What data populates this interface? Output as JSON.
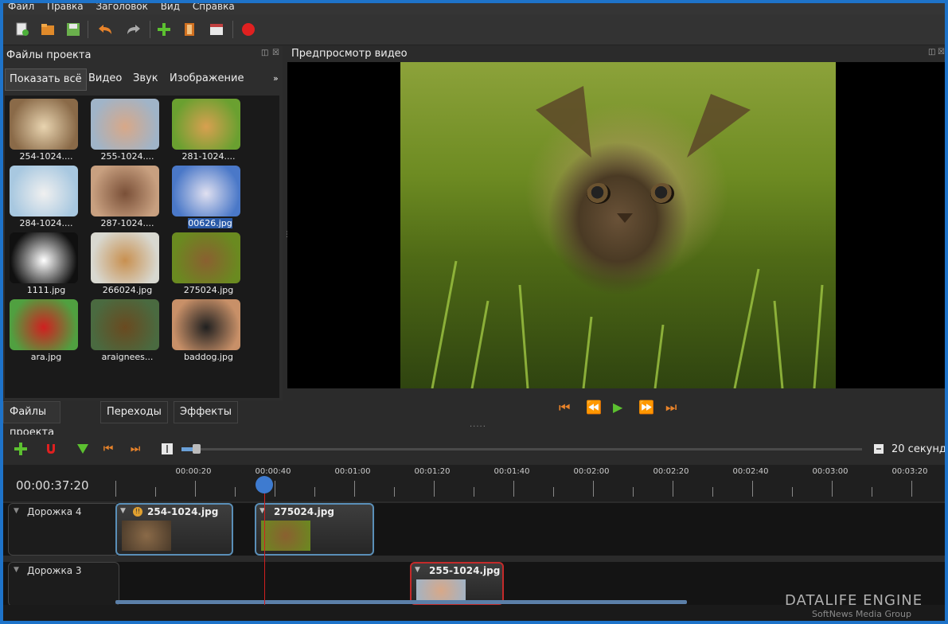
{
  "menu": [
    "Файл",
    "Правка",
    "Заголовок",
    "Вид",
    "Справка"
  ],
  "left_panel": {
    "title": "Файлы проекта",
    "filters": [
      "Показать всё",
      "Видео",
      "Звук",
      "Изображение"
    ],
    "more": "»",
    "files": [
      {
        "name": "254-1024....",
        "color1": "#8a6a48",
        "color2": "#e8d4b0"
      },
      {
        "name": "255-1024....",
        "color1": "#a0b4c8",
        "color2": "#d8a888"
      },
      {
        "name": "281-1024....",
        "color1": "#6aa030",
        "color2": "#d8a050"
      },
      {
        "name": "284-1024....",
        "color1": "#a8c8e0",
        "color2": "#f0f0f0"
      },
      {
        "name": "287-1024....",
        "color1": "#c8a080",
        "color2": "#7a5038"
      },
      {
        "name": "00626.jpg",
        "color1": "#4a78c8",
        "color2": "#e0e0f0",
        "selected": true
      },
      {
        "name": "1111.jpg",
        "color1": "#101010",
        "color2": "#ffffff"
      },
      {
        "name": "266024.jpg",
        "color1": "#d8d8d0",
        "color2": "#c89050"
      },
      {
        "name": "275024.jpg",
        "color1": "#6a8a20",
        "color2": "#8a6030"
      },
      {
        "name": "ara.jpg",
        "color1": "#50a040",
        "color2": "#d02020"
      },
      {
        "name": "araignees...",
        "color1": "#4a6a40",
        "color2": "#6a4a20"
      },
      {
        "name": "baddog.jpg",
        "color1": "#c89068",
        "color2": "#202020"
      }
    ]
  },
  "bottom_tabs": [
    "Файлы проекта",
    "Переходы",
    "Эффекты"
  ],
  "preview": {
    "title": "Предпросмотр видео"
  },
  "timeline": {
    "zoom_label": "20 секунд",
    "current_time": "00:00:37:20",
    "tick_labels": [
      "00:00:20",
      "00:00:40",
      "00:01:00",
      "00:01:20",
      "00:01:40",
      "00:02:00",
      "00:02:20",
      "00:02:40",
      "00:03:00",
      "00:03:20"
    ],
    "tracks": [
      {
        "name": "Дорожка 4",
        "clips": [
          {
            "label": "254-1024.jpg",
            "border": "blue"
          },
          {
            "label": "275024.jpg",
            "border": "blue"
          }
        ]
      },
      {
        "name": "Дорожка 3",
        "clips": [
          {
            "label": "255-1024.jpg",
            "border": "red"
          }
        ]
      }
    ]
  },
  "watermark": {
    "line1": "DATALIFE ENGINE",
    "line2": "SoftNews Media Group"
  }
}
